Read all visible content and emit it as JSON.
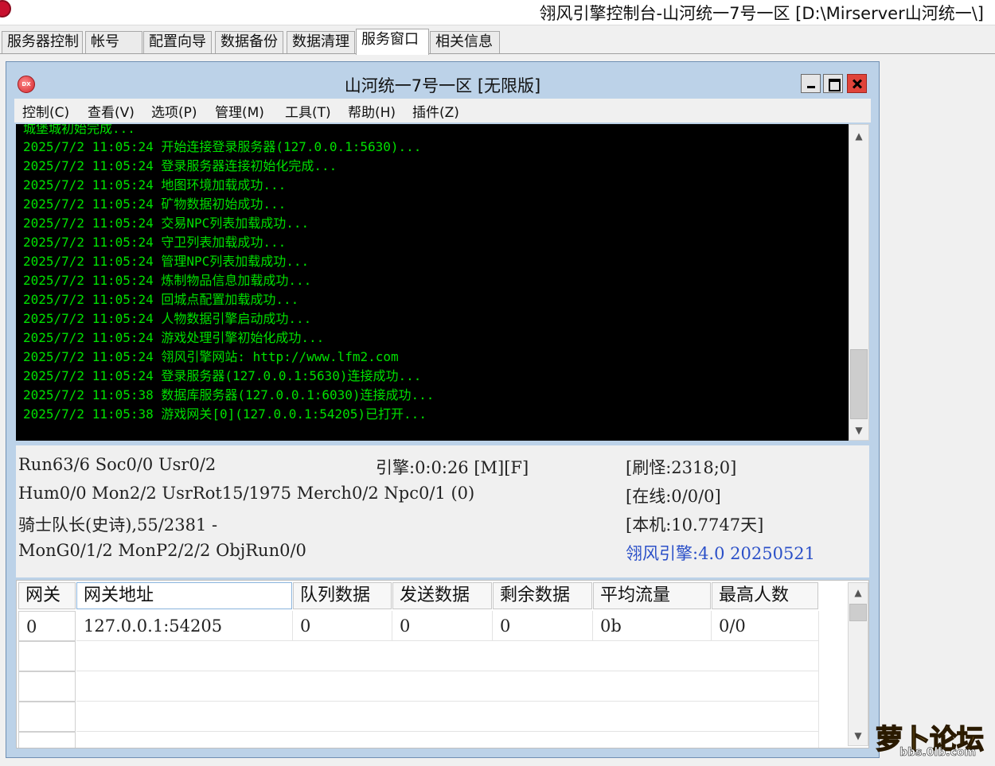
{
  "window": {
    "title": "翎风引擎控制台-山河统一7号一区 [D:\\Mirserver山河统一\\]"
  },
  "tabs": [
    {
      "label": "服务器控制"
    },
    {
      "label": "帐号"
    },
    {
      "label": "配置向导"
    },
    {
      "label": "数据备份"
    },
    {
      "label": "数据清理"
    },
    {
      "label": "服务窗口",
      "active": true
    },
    {
      "label": "相关信息"
    }
  ],
  "child": {
    "title": "山河统一7号一区 [无限版]",
    "icon_text": "DX",
    "menu": [
      "控制(C)",
      "查看(V)",
      "选项(P)",
      "管理(M)",
      "工具(T)",
      "帮助(H)",
      "插件(Z)"
    ]
  },
  "log": {
    "partial_top": "城堡城初始完成...",
    "lines": [
      "2025/7/2 11:05:24 开始连接登录服务器(127.0.0.1:5630)...",
      "2025/7/2 11:05:24 登录服务器连接初始化完成...",
      "2025/7/2 11:05:24 地图环境加载成功...",
      "2025/7/2 11:05:24 矿物数据初始成功...",
      "2025/7/2 11:05:24 交易NPC列表加载成功...",
      "2025/7/2 11:05:24 守卫列表加载成功...",
      "2025/7/2 11:05:24 管理NPC列表加载成功...",
      "2025/7/2 11:05:24 炼制物品信息加载成功...",
      "2025/7/2 11:05:24 回城点配置加载成功...",
      "2025/7/2 11:05:24 人物数据引擎启动成功...",
      "2025/7/2 11:05:24 游戏处理引擎初始化成功...",
      "2025/7/2 11:05:24 翎风引擎网站: http://www.lfm2.com",
      "2025/7/2 11:05:24 登录服务器(127.0.0.1:5630)连接成功...",
      "2025/7/2 11:05:38 数据库服务器(127.0.0.1:6030)连接成功...",
      "2025/7/2 11:05:38 游戏网关[0](127.0.0.1:54205)已打开..."
    ]
  },
  "status": {
    "line1": "Run63/6 Soc0/0 Usr0/2",
    "engine": "引擎:0:0:26 [M][F]",
    "refresh": "[刷怪:2318;0]",
    "line2": "Hum0/0 Mon2/2 UsrRot15/1975 Merch0/2 Npc0/1 (0)",
    "online": "[在线:0/0/0]",
    "line3": "骑士队长(史诗),55/2381 -",
    "local": "[本机:10.7747天]",
    "line4": "MonG0/1/2 MonP2/2/2 ObjRun0/0",
    "version": "翎风引擎:4.0 20250521"
  },
  "gateway": {
    "columns": [
      "网关",
      "网关地址",
      "队列数据",
      "发送数据",
      "剩余数据",
      "平均流量",
      "最高人数"
    ],
    "rows": [
      [
        "0",
        "127.0.0.1:54205",
        "0",
        "0",
        "0",
        "0b",
        "0/0"
      ]
    ]
  },
  "watermark": {
    "text": "萝卜论坛",
    "url": "bbs.0lb.com"
  }
}
